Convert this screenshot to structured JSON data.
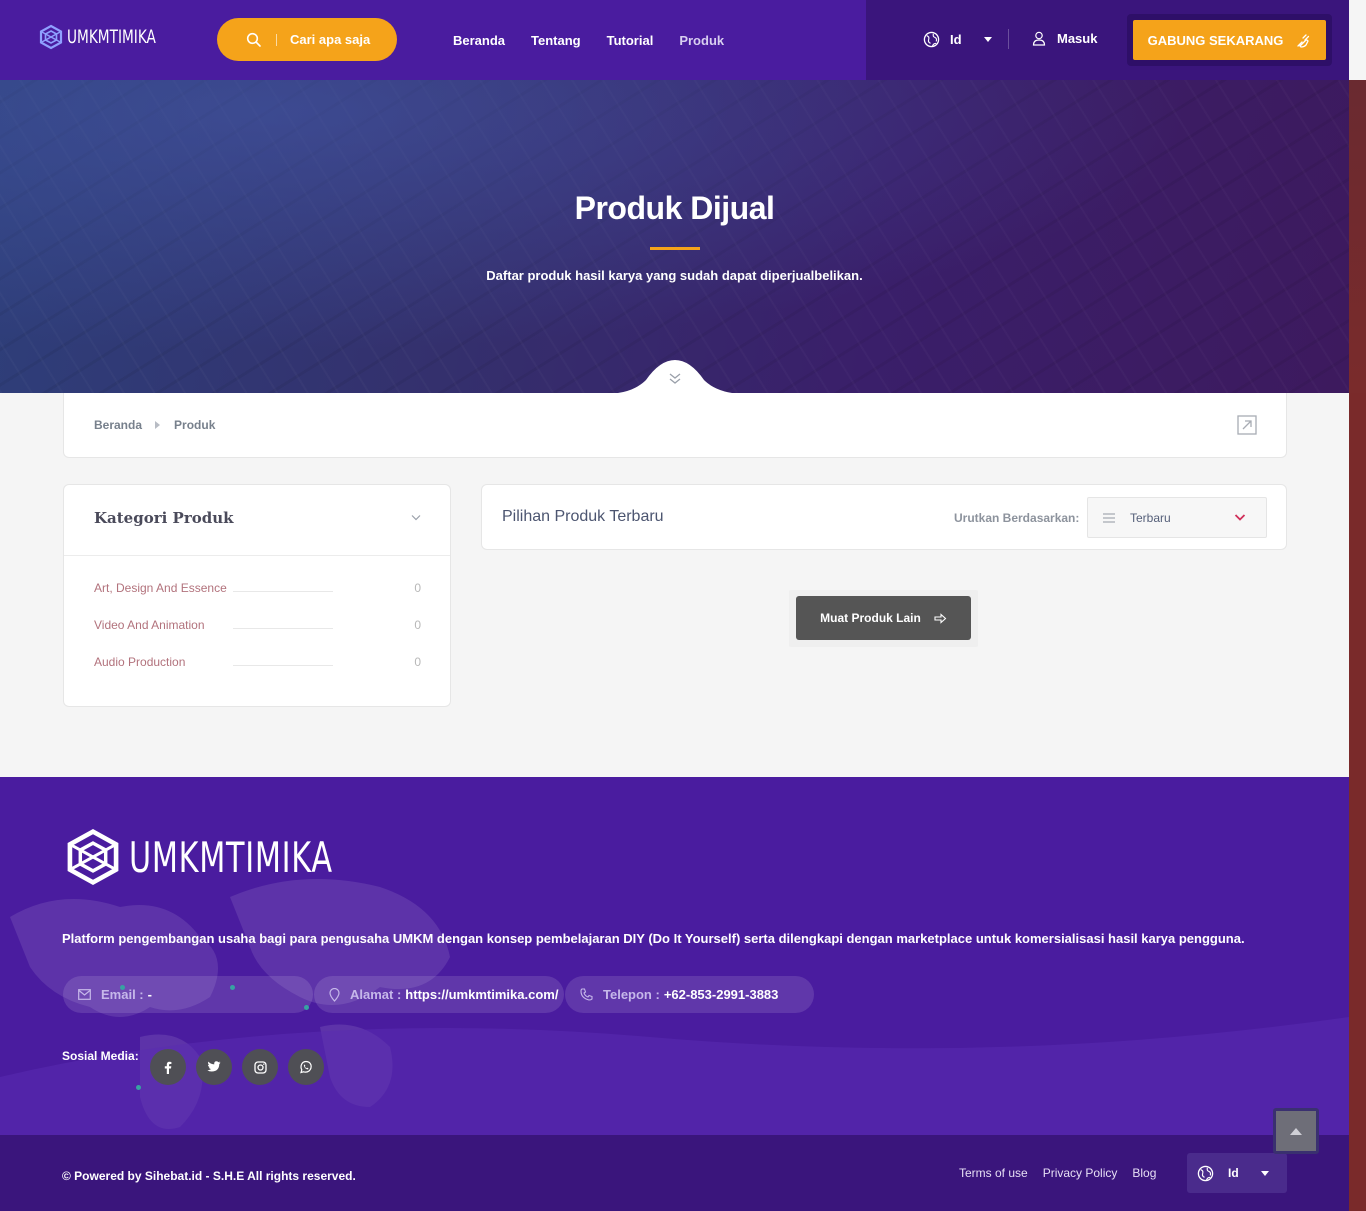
{
  "header": {
    "logo_text": "UMKMTIMIKA",
    "search_placeholder": "Cari apa saja",
    "nav": [
      "Beranda",
      "Tentang",
      "Tutorial",
      "Produk"
    ],
    "language": "Id",
    "login": "Masuk",
    "join": "GABUNG SEKARANG"
  },
  "hero": {
    "title": "Produk Dijual",
    "subtitle": "Daftar produk hasil karya yang sudah dapat diperjualbelikan."
  },
  "breadcrumb": [
    "Beranda",
    "Produk"
  ],
  "sidebar": {
    "title": "Kategori Produk",
    "categories": [
      {
        "name": "Art, Design And Essence",
        "count": "0"
      },
      {
        "name": "Video And Animation",
        "count": "0"
      },
      {
        "name": "Audio Production",
        "count": "0"
      }
    ]
  },
  "main": {
    "title": "Pilihan Produk Terbaru",
    "sort_label": "Urutkan Berdasarkan:",
    "sort_value": "Terbaru",
    "load_more": "Muat Produk Lain"
  },
  "footer": {
    "logo_text": "UMKMTIMIKA",
    "description": "Platform pengembangan usaha bagi para pengusaha UMKM dengan konsep pembelajaran DIY (Do It Yourself) serta dilengkapi dengan marketplace untuk komersialisasi hasil karya pengguna.",
    "email_label": "Email :",
    "email_value": "-",
    "address_label": "Alamat :",
    "address_value": "https://umkmtimika.com/",
    "phone_label": "Telepon :",
    "phone_value": "+62-853-2991-3883",
    "social_label": "Sosial Media:",
    "social_icons": [
      "facebook-icon",
      "twitter-icon",
      "instagram-icon",
      "whatsapp-icon"
    ]
  },
  "bottom": {
    "copyright": "© Powered by Sihebat.id - S.H.E All rights reserved.",
    "links": [
      "Terms of use",
      "Privacy Policy",
      "Blog"
    ],
    "language": "Id"
  },
  "colors": {
    "primary": "#4a1c9f",
    "accent": "#f5a31a",
    "dark": "#3a157c"
  }
}
